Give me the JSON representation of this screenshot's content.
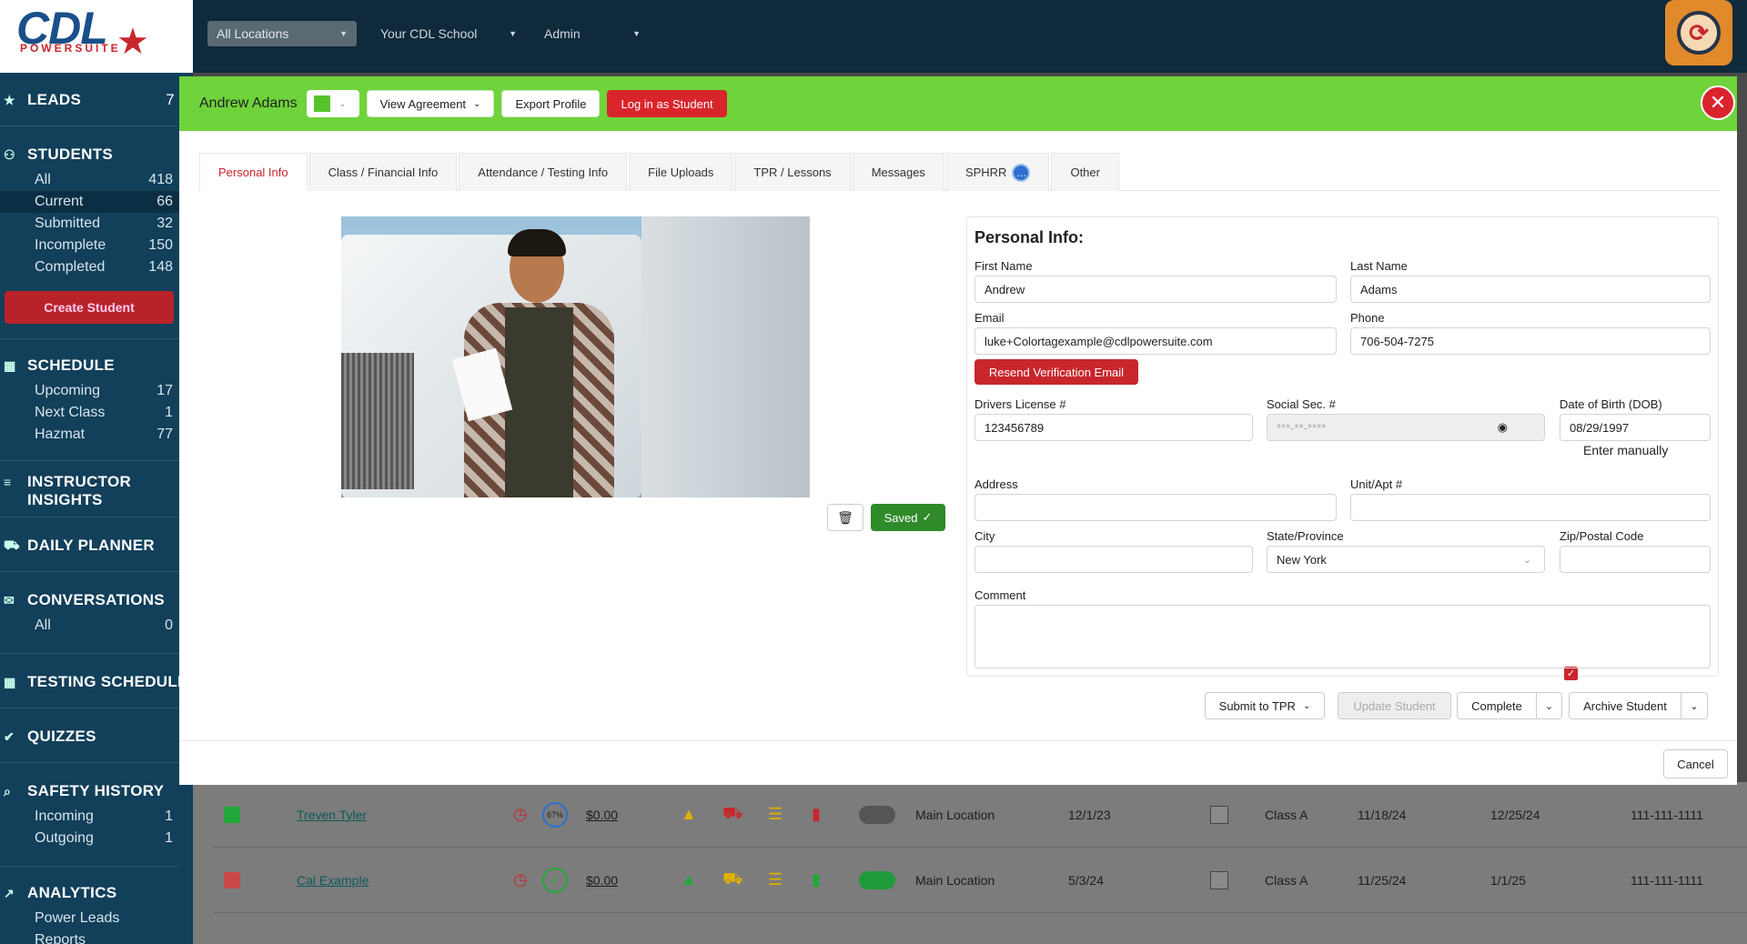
{
  "topbar": {
    "location": "All Locations",
    "school": "Your CDL School",
    "role": "Admin",
    "logo_text": "CDL",
    "logo_sub": "POWERSUITE"
  },
  "sidebar": {
    "leads": {
      "label": "LEADS",
      "count": "7"
    },
    "students": {
      "label": "STUDENTS",
      "items": [
        {
          "label": "All",
          "count": "418"
        },
        {
          "label": "Current",
          "count": "66"
        },
        {
          "label": "Submitted",
          "count": "32"
        },
        {
          "label": "Incomplete",
          "count": "150"
        },
        {
          "label": "Completed",
          "count": "148"
        }
      ],
      "create": "Create Student"
    },
    "schedule": {
      "label": "SCHEDULE",
      "items": [
        {
          "label": "Upcoming",
          "count": "17"
        },
        {
          "label": "Next Class",
          "count": "1"
        },
        {
          "label": "Hazmat",
          "count": "77"
        }
      ]
    },
    "insights": {
      "line1": "INSTRUCTOR",
      "line2": "INSIGHTS"
    },
    "planner": "DAILY PLANNER",
    "conversations": {
      "label": "CONVERSATIONS",
      "items": [
        {
          "label": "All",
          "count": "0"
        }
      ]
    },
    "testing": "TESTING SCHEDULE",
    "quizzes": "QUIZZES",
    "safety": {
      "label": "SAFETY HISTORY",
      "items": [
        {
          "label": "Incoming",
          "count": "1"
        },
        {
          "label": "Outgoing",
          "count": "1"
        }
      ]
    },
    "analytics": {
      "label": "ANALYTICS",
      "items": [
        {
          "label": "Power Leads"
        },
        {
          "label": "Reports"
        }
      ]
    }
  },
  "modal": {
    "name": "Andrew Adams",
    "view_agreement": "View Agreement",
    "export_profile": "Export Profile",
    "login_student": "Log in as Student",
    "tabs": [
      "Personal Info",
      "Class / Financial Info",
      "Attendance / Testing Info",
      "File Uploads",
      "TPR / Lessons",
      "Messages",
      "SPHRR",
      "Other"
    ],
    "saved": "Saved",
    "form": {
      "title": "Personal Info:",
      "first_name_label": "First Name",
      "first_name": "Andrew",
      "last_name_label": "Last Name",
      "last_name": "Adams",
      "email_label": "Email",
      "email": "luke+Colortagexample@cdlpowersuite.com",
      "phone_label": "Phone",
      "phone": "706-504-7275",
      "resend": "Resend Verification Email",
      "license_label": "Drivers License #",
      "license": "123456789",
      "ssn_label": "Social Sec. #",
      "ssn": "***-**-****",
      "dob_label": "Date of Birth (DOB)",
      "dob": "08/29/1997",
      "enter_manually": "Enter manually",
      "address_label": "Address",
      "unit_label": "Unit/Apt #",
      "city_label": "City",
      "state_label": "State/Province",
      "state": "New York",
      "zip_label": "Zip/Postal Code",
      "comment_label": "Comment"
    },
    "actions": {
      "submit_tpr": "Submit to TPR",
      "update": "Update Student",
      "complete": "Complete",
      "archive": "Archive Student",
      "cancel": "Cancel"
    }
  },
  "table_rows": [
    {
      "name": "Treven Tyler",
      "pct": "67%",
      "amount": "$0.00",
      "location": "Main Location",
      "date1": "12/1/23",
      "class": "Class A",
      "date2": "11/18/24",
      "date3": "12/25/24",
      "phone": "111-111-1111"
    },
    {
      "name": "Cal Example",
      "pct": "",
      "amount": "$0.00",
      "location": "Main Location",
      "date1": "5/3/24",
      "class": "Class A",
      "date2": "11/25/24",
      "date3": "1/1/25",
      "phone": "111-111-1111"
    }
  ],
  "colors": {
    "header_green": "#6fd33b",
    "brand_red": "#c8262c",
    "sidebar": "#123f5a",
    "topbar": "#0e2a3b"
  }
}
